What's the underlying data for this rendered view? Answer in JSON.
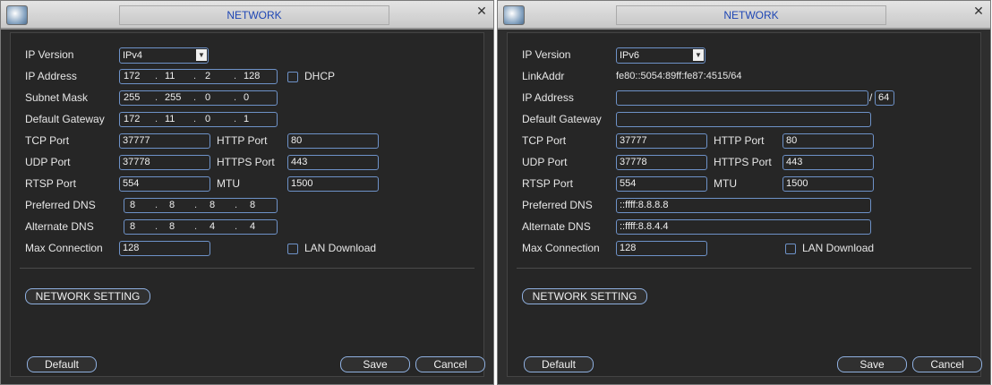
{
  "left": {
    "title": "NETWORK",
    "labels": {
      "ip_version": "IP Version",
      "ip_address": "IP Address",
      "subnet_mask": "Subnet Mask",
      "default_gateway": "Default Gateway",
      "tcp_port": "TCP Port",
      "http_port": "HTTP Port",
      "udp_port": "UDP Port",
      "https_port": "HTTPS Port",
      "rtsp_port": "RTSP Port",
      "mtu": "MTU",
      "preferred_dns": "Preferred DNS",
      "alternate_dns": "Alternate DNS",
      "max_connection": "Max Connection",
      "dhcp": "DHCP",
      "lan_download": "LAN Download"
    },
    "ip_version": "IPv4",
    "ip_address": [
      "172",
      "11",
      "2",
      "128"
    ],
    "subnet_mask": [
      "255",
      "255",
      "0",
      "0"
    ],
    "default_gateway": [
      "172",
      "11",
      "0",
      "1"
    ],
    "tcp_port": "37777",
    "http_port": "80",
    "udp_port": "37778",
    "https_port": "443",
    "rtsp_port": "554",
    "mtu": "1500",
    "preferred_dns": [
      "8",
      "8",
      "8",
      "8"
    ],
    "alternate_dns": [
      "8",
      "8",
      "4",
      "4"
    ],
    "max_connection": "128",
    "network_setting": "NETWORK SETTING",
    "default_button": "Default",
    "save_button": "Save",
    "cancel_button": "Cancel"
  },
  "right": {
    "title": "NETWORK",
    "labels": {
      "ip_version": "IP Version",
      "link_addr": "LinkAddr",
      "ip_address": "IP Address",
      "default_gateway": "Default Gateway",
      "tcp_port": "TCP Port",
      "http_port": "HTTP Port",
      "udp_port": "UDP Port",
      "https_port": "HTTPS Port",
      "rtsp_port": "RTSP Port",
      "mtu": "MTU",
      "preferred_dns": "Preferred DNS",
      "alternate_dns": "Alternate DNS",
      "max_connection": "Max Connection",
      "lan_download": "LAN Download"
    },
    "ip_version": "IPv6",
    "link_addr": "fe80::5054:89ff:fe87:4515/64",
    "ip_address": "",
    "prefix_sep": "/",
    "prefix": "64",
    "default_gateway": "",
    "tcp_port": "37777",
    "http_port": "80",
    "udp_port": "37778",
    "https_port": "443",
    "rtsp_port": "554",
    "mtu": "1500",
    "preferred_dns": "::ffff:8.8.8.8",
    "alternate_dns": "::ffff:8.8.4.4",
    "max_connection": "128",
    "network_setting": "NETWORK SETTING",
    "default_button": "Default",
    "save_button": "Save",
    "cancel_button": "Cancel"
  },
  "icons": {
    "app": "network-app-icon",
    "close": "close-icon",
    "dropdown": "chevron-down-icon"
  },
  "colors": {
    "title_text": "#1e46b4",
    "field_border": "#6e92c8",
    "panel_bg": "#262626"
  }
}
